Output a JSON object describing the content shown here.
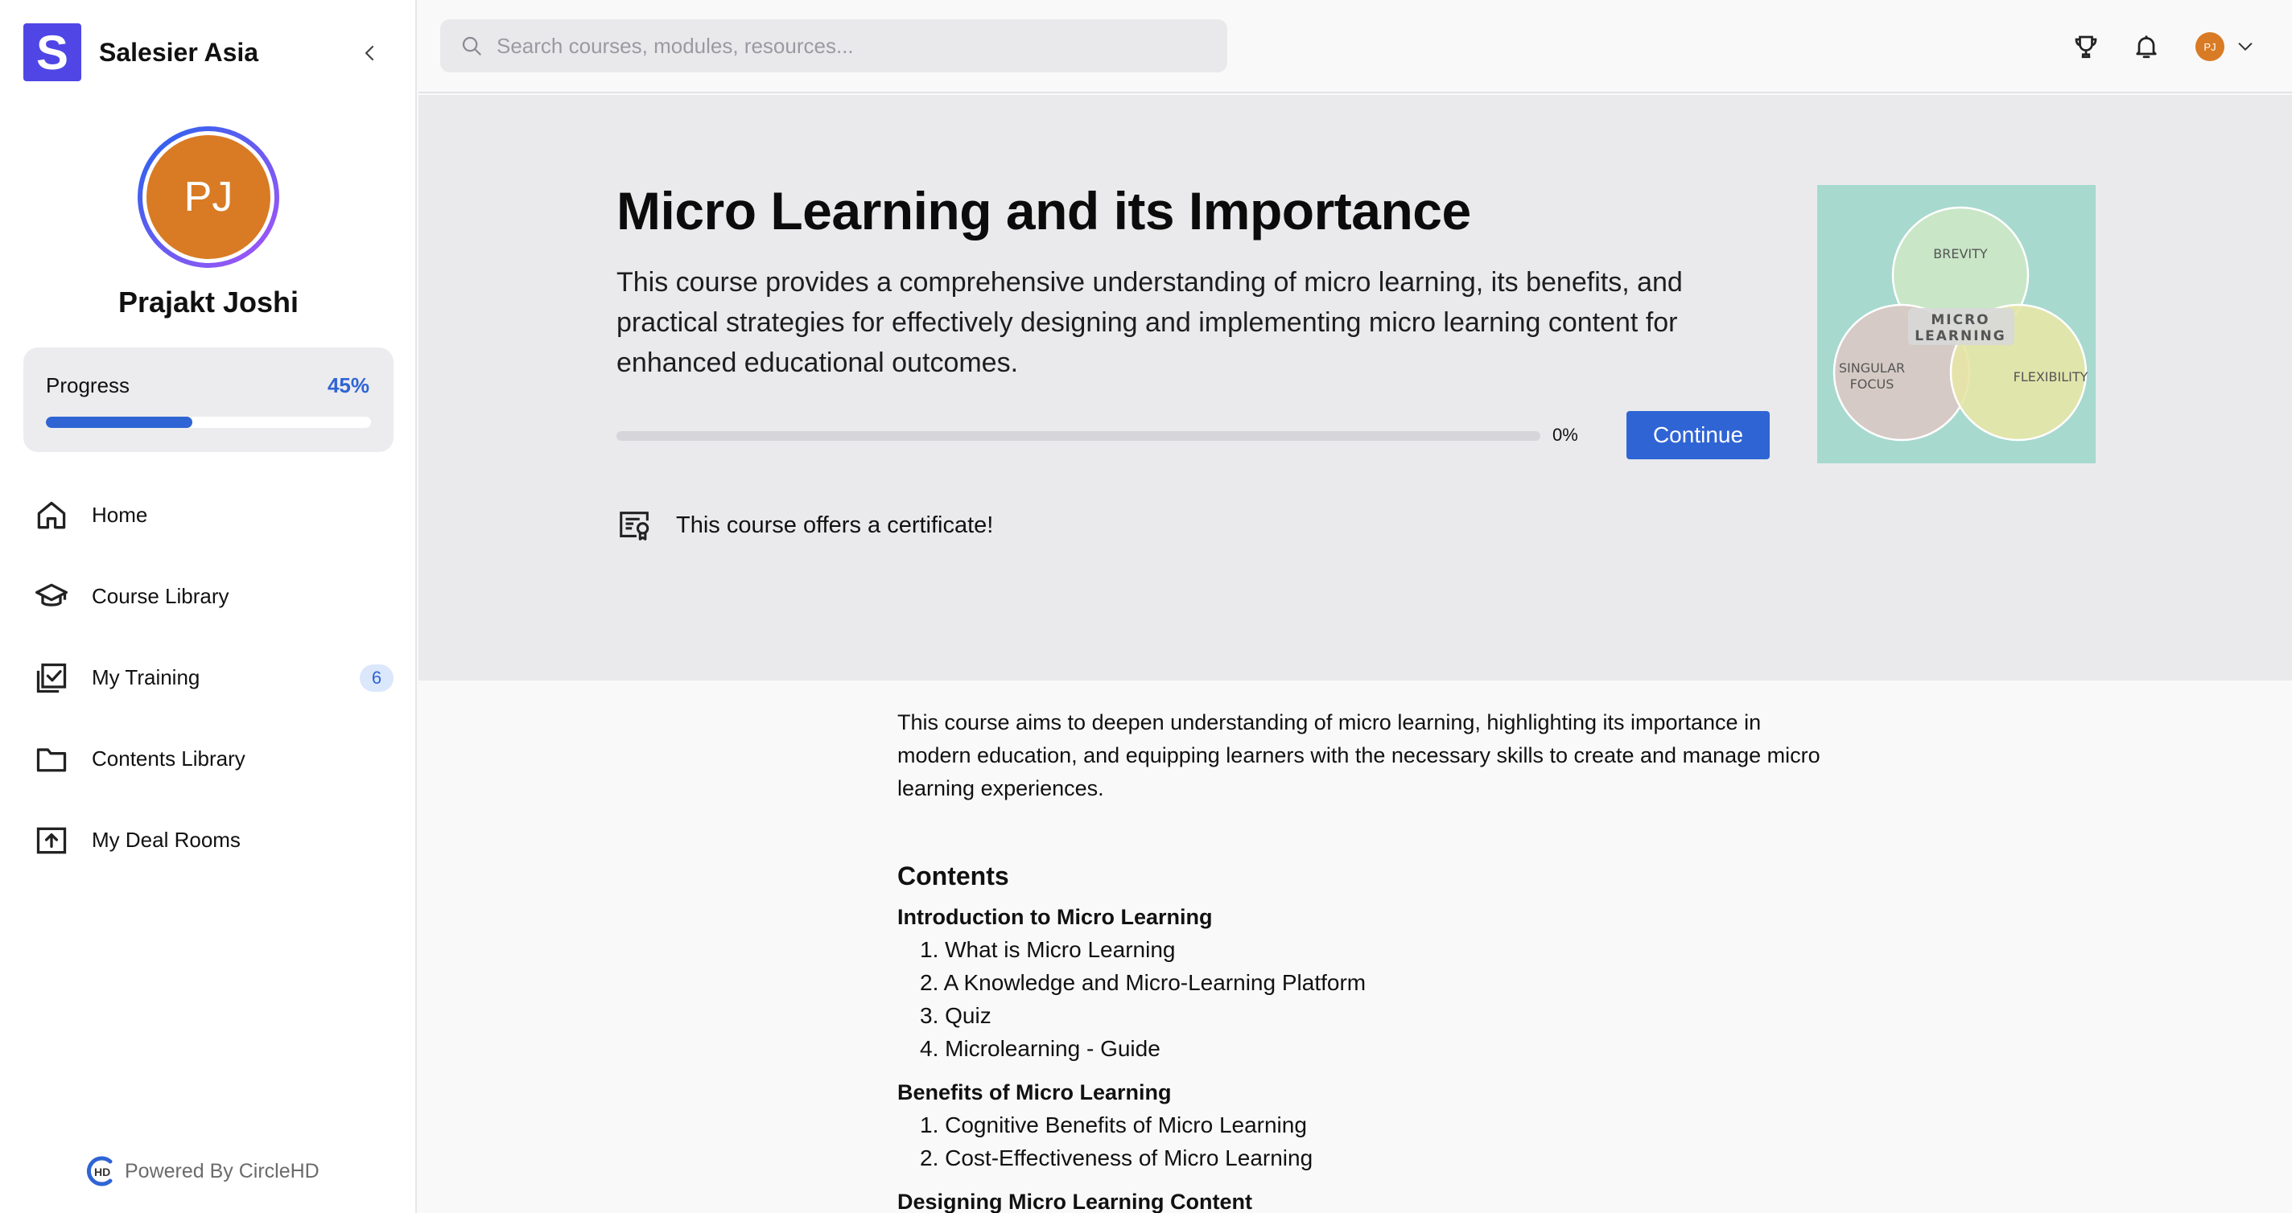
{
  "brand": {
    "initial": "S",
    "name": "Salesier Asia"
  },
  "user": {
    "initials": "PJ",
    "name": "Prajakt Joshi"
  },
  "progress": {
    "label": "Progress",
    "value_text": "45%",
    "fraction": 0.45
  },
  "nav": {
    "items": [
      {
        "label": "Home",
        "icon": "home-icon"
      },
      {
        "label": "Course Library",
        "icon": "graduation-cap-icon"
      },
      {
        "label": "My Training",
        "icon": "checklist-icon",
        "badge": "6"
      },
      {
        "label": "Contents Library",
        "icon": "folder-icon"
      },
      {
        "label": "My Deal Rooms",
        "icon": "upload-box-icon"
      }
    ]
  },
  "footer": {
    "powered_by": "Powered By CircleHD"
  },
  "search": {
    "placeholder": "Search courses, modules, resources..."
  },
  "topbar": {
    "avatar_initials": "PJ",
    "icons": [
      "trophy-icon",
      "bell-icon",
      "chevron-down-icon"
    ]
  },
  "course": {
    "title": "Micro Learning and its Importance",
    "description": "This course provides a comprehensive understanding of micro learning, its benefits, and practical strategies for effectively designing and implementing micro learning content for enhanced educational outcomes.",
    "progress_text": "0%",
    "progress_fraction": 0,
    "continue_label": "Continue",
    "certificate_text": "This course offers a certificate!",
    "image": {
      "center_line1": "MICRO",
      "center_line2": "LEARNING",
      "top": "BREVITY",
      "left_line1": "SINGULAR",
      "left_line2": "FOCUS",
      "right": "FLEXIBILITY"
    },
    "intro": "This course aims to deepen understanding of micro learning, highlighting its importance in modern education, and equipping learners with the necessary skills to create and manage micro learning experiences.",
    "contents_heading": "Contents",
    "sections": [
      {
        "title": "Introduction to Micro Learning",
        "modules": [
          "1. What is Micro Learning",
          "2. A Knowledge and Micro-Learning Platform",
          "3. Quiz",
          "4. Microlearning - Guide"
        ]
      },
      {
        "title": "Benefits of Micro Learning",
        "modules": [
          "1. Cognitive Benefits of Micro Learning",
          "2. Cost-Effectiveness of Micro Learning"
        ]
      },
      {
        "title": "Designing Micro Learning Content",
        "modules": []
      }
    ]
  },
  "colors": {
    "brand": "#4f46e5",
    "accent": "#2f64d4",
    "avatar": "#d97b24",
    "hero_bg": "#eaeaec"
  }
}
